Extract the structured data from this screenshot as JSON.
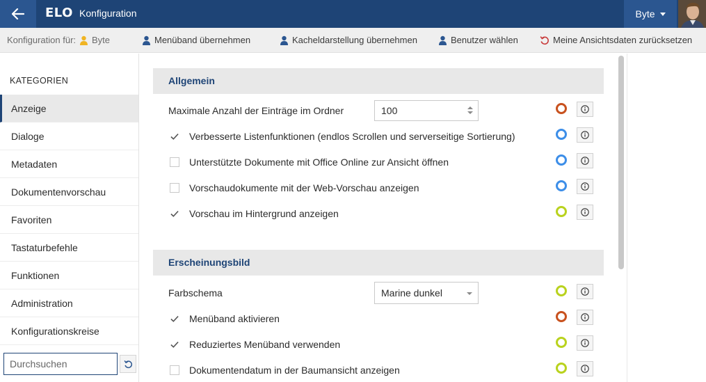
{
  "header": {
    "logo": "ELO",
    "title": "Konfiguration",
    "user": "Byte",
    "back_icon": "arrow-left-icon",
    "caret_icon": "chevron-down-icon"
  },
  "toolbar": {
    "config_for_label": "Konfiguration für:",
    "config_for_user": "Byte",
    "ribbon": "Menüband übernehmen",
    "tiles": "Kacheldarstellung übernehmen",
    "select_users": "Benutzer wählen",
    "reset_views": "Meine Ansichtsdaten zurücksetzen"
  },
  "sidebar": {
    "heading": "KATEGORIEN",
    "items": [
      {
        "label": "Anzeige",
        "active": true
      },
      {
        "label": "Dialoge"
      },
      {
        "label": "Metadaten"
      },
      {
        "label": "Dokumentenvorschau"
      },
      {
        "label": "Favoriten"
      },
      {
        "label": "Tastaturbefehle"
      },
      {
        "label": "Funktionen"
      },
      {
        "label": "Administration"
      },
      {
        "label": "Konfigurationskreise"
      }
    ],
    "search_placeholder": "Durchsuchen"
  },
  "sections": [
    {
      "title": "Allgemein",
      "rows": [
        {
          "label": "Maximale Anzahl der Einträge im Ordner",
          "type": "number",
          "value": "100",
          "status": "orange"
        },
        {
          "label": "Verbesserte Listenfunktionen (endlos Scrollen und serverseitige Sortierung)",
          "type": "checkbox",
          "checked": true,
          "status": "blue"
        },
        {
          "label": "Unterstützte Dokumente mit Office Online zur Ansicht öffnen",
          "type": "checkbox",
          "checked": false,
          "status": "blue"
        },
        {
          "label": "Vorschaudokumente mit der Web-Vorschau anzeigen",
          "type": "checkbox",
          "checked": false,
          "status": "blue"
        },
        {
          "label": "Vorschau im Hintergrund anzeigen",
          "type": "checkbox",
          "checked": true,
          "status": "green"
        }
      ]
    },
    {
      "title": "Erscheinungsbild",
      "rows": [
        {
          "label": "Farbschema",
          "type": "select",
          "value": "Marine dunkel",
          "status": "green"
        },
        {
          "label": "Menüband aktivieren",
          "type": "checkbox",
          "checked": true,
          "status": "orange"
        },
        {
          "label": "Reduziertes Menüband verwenden",
          "type": "checkbox",
          "checked": true,
          "status": "green"
        },
        {
          "label": "Dokumentendatum in der Baumansicht anzeigen",
          "type": "checkbox",
          "checked": false,
          "status": "green"
        }
      ]
    }
  ],
  "colors": {
    "brand": "#1e4476",
    "status_orange": "#c8511e",
    "status_blue": "#3d8ee8",
    "status_green": "#b9d21e"
  }
}
